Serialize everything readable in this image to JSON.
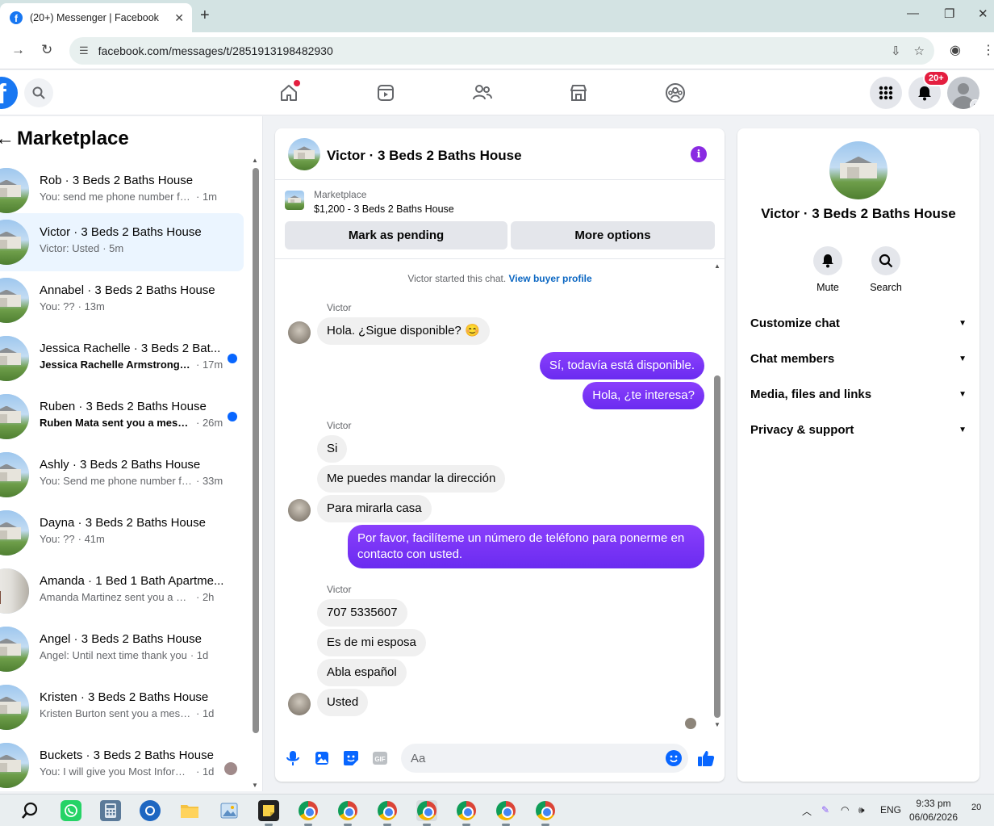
{
  "browser": {
    "tab_title": "(20+) Messenger | Facebook",
    "url": "facebook.com/messages/t/2851913198482930"
  },
  "fb": {
    "notif_badge": "20+"
  },
  "sidebar": {
    "title": "Marketplace",
    "conversations": [
      {
        "name": "Rob · 3 Beds 2 Baths House",
        "preview": "You: send me phone number for c...",
        "time": "· 1m",
        "unread": false,
        "active": false
      },
      {
        "name": "Victor · 3 Beds 2 Baths House",
        "preview": "Victor: Usted",
        "time": "· 5m",
        "unread": false,
        "active": true
      },
      {
        "name": "Annabel · 3 Beds 2 Baths House",
        "preview": "You: ??",
        "time": "· 13m",
        "unread": false,
        "active": false
      },
      {
        "name": "Jessica Rachelle · 3 Beds 2 Bat...",
        "preview": "Jessica Rachelle Armstrong se...",
        "time": "· 17m",
        "unread": true,
        "active": false
      },
      {
        "name": "Ruben · 3 Beds 2 Baths House",
        "preview": "Ruben Mata sent you a messa...",
        "time": "· 26m",
        "unread": true,
        "active": false
      },
      {
        "name": "Ashly · 3 Beds 2 Baths House",
        "preview": "You: Send me phone number for ...",
        "time": "· 33m",
        "unread": false,
        "active": false
      },
      {
        "name": "Dayna · 3 Beds 2 Baths House",
        "preview": "You: ??",
        "time": "· 41m",
        "unread": false,
        "active": false
      },
      {
        "name": "Amanda · 1 Bed 1 Bath Apartme...",
        "preview": "Amanda Martinez sent you a messa...",
        "time": "· 2h",
        "unread": false,
        "active": false
      },
      {
        "name": "Angel · 3 Beds 2 Baths House",
        "preview": "Angel: Until next time thank you",
        "time": "· 1d",
        "unread": false,
        "active": false
      },
      {
        "name": "Kristen · 3 Beds 2 Baths House",
        "preview": "Kristen Burton sent you a message ...",
        "time": "· 1d",
        "unread": false,
        "active": false
      },
      {
        "name": "Buckets · 3 Beds 2 Baths House",
        "preview": "You: I will give you Most Informa...",
        "time": "· 1d",
        "unread": false,
        "active": false
      }
    ]
  },
  "chat": {
    "title": "Victor · 3 Beds 2 Baths House",
    "marketplace_label": "Marketplace",
    "listing": "$1,200 - 3 Beds 2 Baths House",
    "mark_pending": "Mark as pending",
    "more_options": "More options",
    "started_text": "Victor started this chat.",
    "view_buyer": "View buyer profile",
    "sender": "Victor",
    "messages": {
      "m1": "Hola. ¿Sigue disponible? 😊",
      "m2": "Sí, todavía está disponible.",
      "m3": "Hola, ¿te interesa?",
      "m4": "Si",
      "m5": "Me puedes mandar la dirección",
      "m6": "Para  mirarla casa",
      "m7": "Por favor, facilíteme un número de teléfono para ponerme en contacto con usted.",
      "m8": "707 5335607",
      "m9": "Es de mi esposa",
      "m10": "Abla español",
      "m11": "Usted"
    },
    "composer_placeholder": "Aa"
  },
  "info": {
    "title": "Victor · 3 Beds 2 Baths House",
    "mute": "Mute",
    "search": "Search",
    "rows": [
      "Customize chat",
      "Chat members",
      "Media, files and links",
      "Privacy & support"
    ]
  },
  "taskbar": {
    "lang": "ENG",
    "time": "9:33 pm",
    "date": "06/06/2026",
    "notif_count": "20"
  },
  "colors": {
    "fb_blue": "#1877f2",
    "outgoing_bubble": "#7b2ff7",
    "unread_dot": "#0866ff",
    "badge_red": "#e41e3f"
  }
}
